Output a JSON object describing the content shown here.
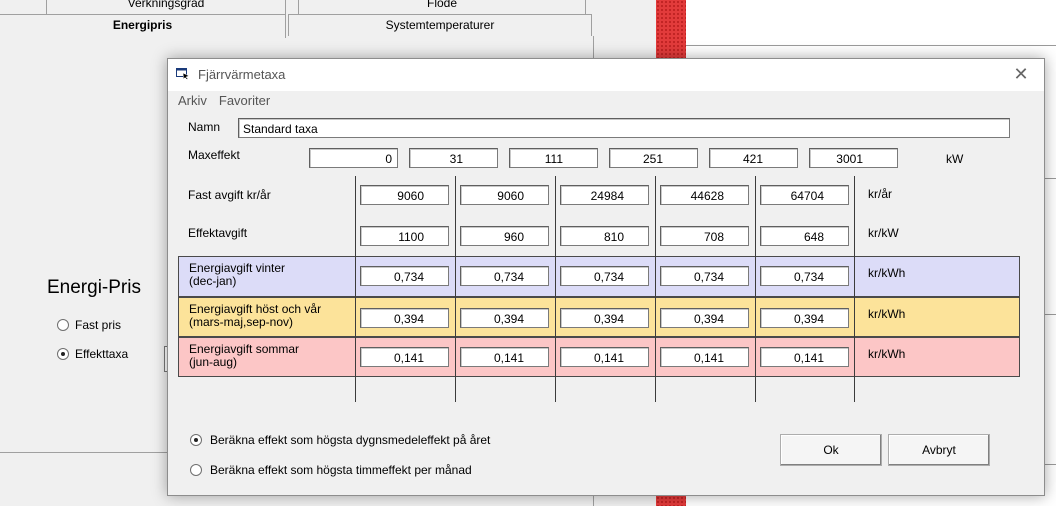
{
  "background": {
    "tabs": {
      "row1_left": "Verkningsgrad",
      "row1_right": "Flöde",
      "energy": "Energipris",
      "systemtemp": "Systemtemperaturer"
    },
    "heading": "Energi-Pris",
    "radio_fixed": "Fast pris",
    "radio_effect": "Effekttaxa"
  },
  "dialog": {
    "title": "Fjärrvärmetaxa",
    "menu": {
      "archive": "Arkiv",
      "favorites": "Favoriter"
    },
    "name_label": "Namn",
    "name_value": "Standard taxa",
    "maxeffekt_label": "Maxeffekt",
    "maxeffekt_values": [
      "0",
      "31",
      "111",
      "251",
      "421",
      "3001"
    ],
    "maxeffekt_unit": "kW",
    "fixed_fee_label": "Fast avgift kr/år",
    "fixed_fee_values": [
      "9060",
      "9060",
      "24984",
      "44628",
      "64704"
    ],
    "fixed_fee_unit": "kr/år",
    "effect_fee_label": "Effektavgift",
    "effect_fee_values": [
      "1100",
      "960",
      "810",
      "708",
      "648"
    ],
    "effect_fee_unit": "kr/kW",
    "winter_label_1": "Energiavgift vinter",
    "winter_label_2": "(dec-jan)",
    "winter_values": [
      "0,734",
      "0,734",
      "0,734",
      "0,734",
      "0,734"
    ],
    "winter_unit": "kr/kWh",
    "autumn_label_1": "Energiavgift höst och vår",
    "autumn_label_2": "(mars-maj,sep-nov)",
    "autumn_values": [
      "0,394",
      "0,394",
      "0,394",
      "0,394",
      "0,394"
    ],
    "autumn_unit": "kr/kWh",
    "summer_label_1": "Energiavgift sommar",
    "summer_label_2": "(jun-aug)",
    "summer_values": [
      "0,141",
      "0,141",
      "0,141",
      "0,141",
      "0,141"
    ],
    "summer_unit": "kr/kWh",
    "radio_daily": "Beräkna effekt som högsta dygnsmedeleffekt på året",
    "radio_hourly": "Beräkna effekt som högsta timmeffekt per månad",
    "ok_label": "Ok",
    "cancel_label": "Avbryt"
  }
}
